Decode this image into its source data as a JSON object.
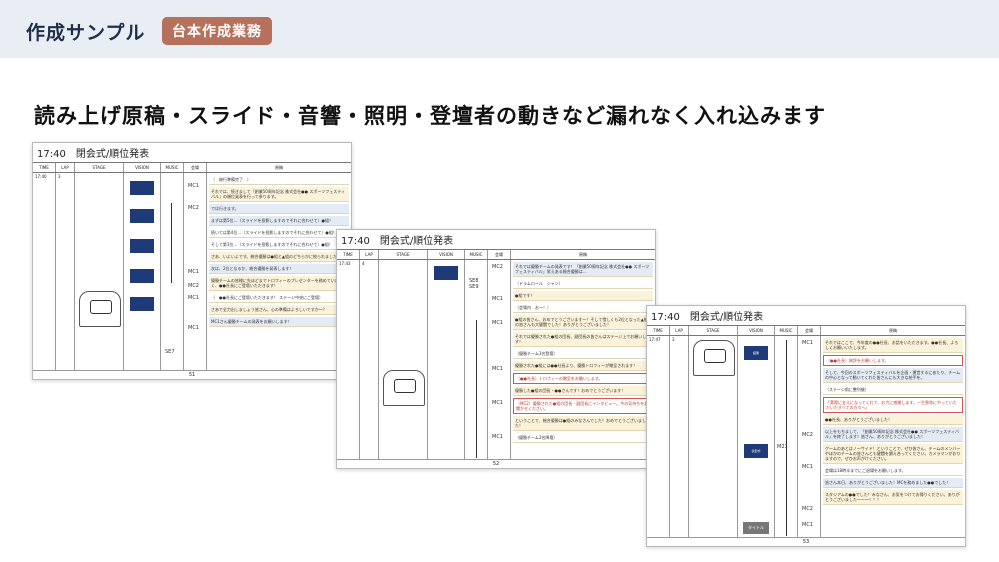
{
  "header": {
    "title": "作成サンプル",
    "badge": "台本作成業務"
  },
  "headline": "読み上げ原稿・スライド・音響・照明・登壇者の動きなど漏れなく入れ込みます",
  "columns": {
    "time": "TIME",
    "lap": "LAP",
    "stage": "STAGE",
    "vision": "VISION",
    "music": "MUSIC",
    "speaker": "会場",
    "script": "原稿"
  },
  "sheets": [
    {
      "title": "17:40　閉会式/順位発表",
      "time": "17:40",
      "lap": "3",
      "page": "51",
      "mc": [
        "MC1",
        "MC2",
        "MC1",
        "MC2",
        "MC1",
        "MC1"
      ],
      "music": [
        "SE7"
      ],
      "blocks": [
        "（　総行準備完了　）",
        "それでは、続きまして「創業50周年記念 株式会社●● スポーツフェスティバル」の順位発表を行って参ります。",
        "では行きます。",
        "まずは第5位…（スライドを投影しますのでそれに合わせて）●組！",
        "続いては第4位…（スライドを投影しますのでそれに合わせて）●組！",
        "そして第3位…（スライドを投影しますのでそれに合わせて）●組！",
        "さあ、いよいよです。総合優勝は●組と▲組のどちらかに絞られました！",
        "次は、2位となるか、総合優勝を発表します！",
        "優勝チームの皆様に先ほどまでトロフィーのプレゼンターを務めていただく、●●社長にご登壇いただきます！",
        "（　●●社長にご登壇いただきます！ ステージ中央にご登壇）",
        "さあで全力出しましょう皆さん、心の準備はよろしいですか～？",
        "MC1さん優勝チームの発表をお願いします！"
      ]
    },
    {
      "title": "17:40　閉会式/順位発表",
      "time": "17:43",
      "lap": "4",
      "page": "52",
      "mc": [
        "MC2",
        "MC1",
        "MC1",
        "MC1",
        "MC1",
        "MC1"
      ],
      "music": [
        "SE8",
        "SE9"
      ],
      "blocks": [
        "それでは優勝チームの発表です！「創業50周年記念 株式会社●● スポーツフェスティバル」栄えある総合優勝は…",
        "（ドラムロール　ジャン）",
        "●組です！",
        "（会場内　おー！）",
        "●組の皆さん、おめでとうございます～！そして惜しくも2位となった▲組の皆さんも大健闘でした！ありがとうございました！",
        "それでは優勝された●組の団長、副団長の皆さんはステージ上でお願いします！",
        "（優勝チーム3名登壇）",
        "優勝された●組には●●社長より、優勝トロフィーが贈呈されます！",
        "（●●社長）トロフィーの贈呈をお願いします。",
        "優勝した●組の団長・●●さんです！おめでとうございます！",
        "（MC2）優勝された●組の団長・副団長にインタビュー。今の気持ちをお聞かせください。",
        "ということで、総合優勝は●組のみなさんでした！おめでとうございました！",
        "（優勝チーム3名降壇）"
      ]
    },
    {
      "title": "17:40　閉会式/順位発表",
      "time": "17:47",
      "lap": "3",
      "page": "53",
      "mc": [
        "MC1",
        "MC2",
        "MC1",
        "MC2",
        "MC1"
      ],
      "music": [
        "M21"
      ],
      "vision_labels": [
        "結果",
        "表彰式",
        "タイトル"
      ],
      "blocks": [
        "それではここで、今年度の●●社長、お話をいただきます。●●社長、よろしくお願いいたします。",
        "（●●社長）総評をお願いします。",
        "そして、今回のスポーツフェスティバルを企画・運営するにあたり、チームの中心となって動いてくれた皆さんにも大きな拍手を。",
        "（ステージ前に整列後）",
        "「実際に支えになってくれて、お力に感謝します。一生懸命にやっていただいたすべての方々へ」",
        "●●社長、ありがとうございました！",
        "以上をもちまして、「創業50周年記念 株式会社●● スポーツフェスティバル」を終了します！皆さん、ありがとうございました！",
        "ゲームのあとはノーサイド！ということで、ぜひ皆さん、チームのメンバーやほかのチームの皆さんとも健闘を讃え合ってください。カメラマンがおりますので、ぜひお声がけください。",
        "会場は18時半までにご退場をお願いします。",
        "皆さん本日、ありがとうございました！MCを務めました●●でした！",
        "スタジアムの●●でした！みなさん、お気をつけてお帰りください。ありがとうございました～～～！！！"
      ]
    }
  ]
}
